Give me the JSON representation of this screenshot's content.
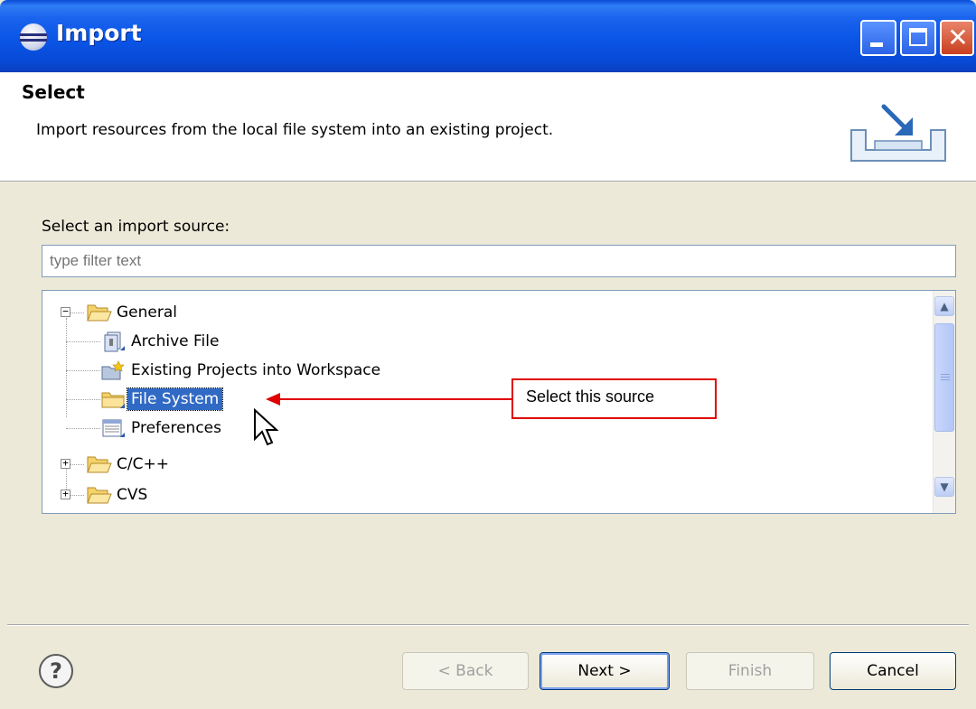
{
  "window": {
    "title": "Import",
    "close_glyph": "✕"
  },
  "header": {
    "title": "Select",
    "description": "Import resources from the local file system into an existing project."
  },
  "filter": {
    "label": "Select an import source:",
    "placeholder": "type filter text"
  },
  "tree": {
    "items": [
      {
        "label": "General",
        "icon": "folder-open-icon",
        "expander": "−"
      },
      {
        "label": "Archive File",
        "icon": "archive-file-icon"
      },
      {
        "label": "Existing Projects into Workspace",
        "icon": "existing-projects-icon"
      },
      {
        "label": "File System",
        "icon": "folder-icon",
        "selected": true
      },
      {
        "label": "Preferences",
        "icon": "preferences-icon"
      },
      {
        "label": "C/C++",
        "icon": "folder-open-icon",
        "expander": "+"
      },
      {
        "label": "CVS",
        "icon": "folder-open-icon",
        "expander": "+"
      }
    ]
  },
  "callout": {
    "text": "Select this source",
    "color": "#e00000"
  },
  "footer": {
    "help_glyph": "?",
    "back_label": "< Back",
    "next_label": "Next >",
    "finish_label": "Finish",
    "cancel_label": "Cancel"
  },
  "colors": {
    "titlebar": "#0a55e6",
    "selection": "#316ac5",
    "dialog_bg": "#ece9d8"
  }
}
